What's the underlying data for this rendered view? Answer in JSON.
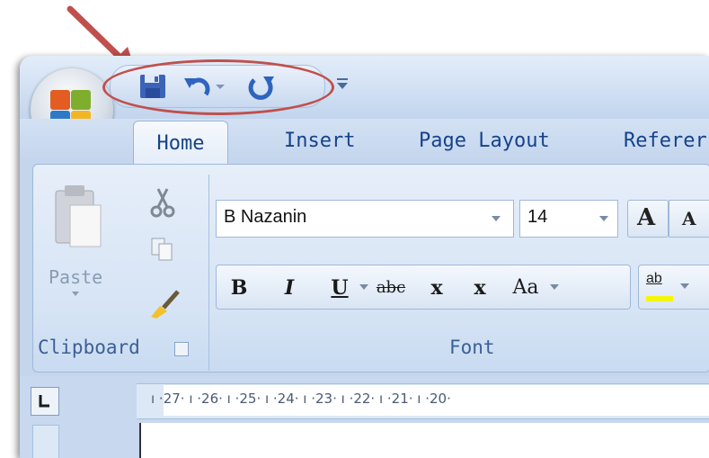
{
  "qat": {
    "save_icon": "save-icon",
    "undo_icon": "undo-icon",
    "redo_icon": "redo-icon",
    "customize_icon": "customize-qat-icon",
    "annotation_color": "#c0504d"
  },
  "tabs": {
    "home": "Home",
    "insert": "Insert",
    "page_layout": "Page Layout",
    "references": "Referer"
  },
  "clipboard": {
    "paste_label": "Paste",
    "group_label": "Clipboard"
  },
  "font": {
    "font_name": "B Nazanin",
    "font_size": "14",
    "bold": "B",
    "italic": "I",
    "underline": "U",
    "strikethrough": "abc",
    "subscript": "x",
    "superscript": "x",
    "change_case": "Aa",
    "highlight": "ab",
    "grow": "A",
    "shrink": "A",
    "group_label": "Font"
  },
  "ruler": {
    "marks": "ı ·27· ı ·26· ı ·25· ı ·24· ı ·23· ı ·22· ı ·21· ı ·20·"
  }
}
